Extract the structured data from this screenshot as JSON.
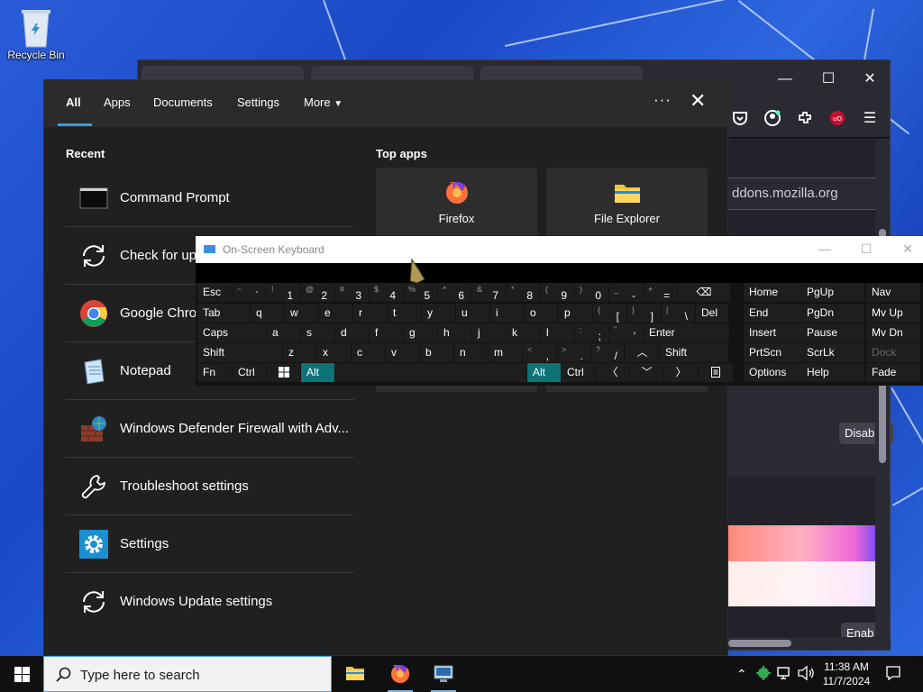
{
  "desktop": {
    "icon_label": "Recycle Bin"
  },
  "firefox_window": {
    "url_partial": "ddons.mozilla.org",
    "button_disable_partial": "Disab",
    "button_enable_partial": "Enab"
  },
  "search_flyout": {
    "tabs": [
      "All",
      "Apps",
      "Documents",
      "Settings",
      "More"
    ],
    "recent_heading": "Recent",
    "top_apps_heading": "Top apps",
    "recent_items": [
      {
        "label": "Command Prompt",
        "icon": "cmd-icon"
      },
      {
        "label": "Check for updates",
        "icon": "refresh-icon"
      },
      {
        "label": "Google Chrome",
        "icon": "chrome-icon"
      },
      {
        "label": "Notepad",
        "icon": "notepad-icon"
      },
      {
        "label": "Windows Defender Firewall with Adv...",
        "icon": "firewall-icon"
      },
      {
        "label": "Troubleshoot settings",
        "icon": "wrench-icon"
      },
      {
        "label": "Settings",
        "icon": "gear-icon"
      },
      {
        "label": "Windows Update settings",
        "icon": "refresh-icon"
      }
    ],
    "top_apps": [
      {
        "label": "Firefox",
        "icon": "firefox-icon"
      },
      {
        "label": "File Explorer",
        "icon": "folder-icon"
      }
    ]
  },
  "osk": {
    "title": "On-Screen Keyboard",
    "row1": [
      {
        "m": "Esc"
      },
      {
        "s": "~",
        "m": "`"
      },
      {
        "s": "!",
        "m": "1"
      },
      {
        "s": "@",
        "m": "2"
      },
      {
        "s": "#",
        "m": "3"
      },
      {
        "s": "$",
        "m": "4"
      },
      {
        "s": "%",
        "m": "5"
      },
      {
        "s": "^",
        "m": "6"
      },
      {
        "s": "&",
        "m": "7"
      },
      {
        "s": "*",
        "m": "8"
      },
      {
        "s": "(",
        "m": "9"
      },
      {
        "s": ")",
        "m": "0"
      },
      {
        "s": "_",
        "m": "-"
      },
      {
        "s": "+",
        "m": "="
      },
      {
        "m": "⌫"
      }
    ],
    "row2": [
      {
        "m": "Tab"
      },
      {
        "m": "q"
      },
      {
        "m": "w"
      },
      {
        "m": "e"
      },
      {
        "m": "r"
      },
      {
        "m": "t"
      },
      {
        "m": "y"
      },
      {
        "m": "u"
      },
      {
        "m": "i"
      },
      {
        "m": "o"
      },
      {
        "m": "p"
      },
      {
        "s": "{",
        "m": "["
      },
      {
        "s": "}",
        "m": "]"
      },
      {
        "s": "|",
        "m": "\\"
      },
      {
        "m": "Del"
      }
    ],
    "row3": [
      {
        "m": "Caps"
      },
      {
        "m": "a"
      },
      {
        "m": "s"
      },
      {
        "m": "d"
      },
      {
        "m": "f"
      },
      {
        "m": "g"
      },
      {
        "m": "h"
      },
      {
        "m": "j"
      },
      {
        "m": "k"
      },
      {
        "m": "l"
      },
      {
        "s": ":",
        "m": ";"
      },
      {
        "s": "\"",
        "m": "'"
      },
      {
        "m": "Enter"
      }
    ],
    "row4": [
      {
        "m": "Shift"
      },
      {
        "m": "z"
      },
      {
        "m": "x"
      },
      {
        "m": "c"
      },
      {
        "m": "v"
      },
      {
        "m": "b"
      },
      {
        "m": "n"
      },
      {
        "m": "m"
      },
      {
        "s": "<",
        "m": ","
      },
      {
        "s": ">",
        "m": "."
      },
      {
        "s": "?",
        "m": "/"
      },
      {
        "m": "^"
      },
      {
        "m": "Shift"
      }
    ],
    "row5": [
      {
        "m": "Fn"
      },
      {
        "m": "Ctrl"
      },
      {
        "m": "win"
      },
      {
        "m": "Alt"
      },
      {
        "m": ""
      },
      {
        "m": "Alt"
      },
      {
        "m": "Ctrl"
      },
      {
        "m": "<"
      },
      {
        "m": "v"
      },
      {
        "m": ">"
      },
      {
        "m": "menu"
      }
    ],
    "nav_keys": [
      [
        "Home",
        "PgUp",
        "Nav"
      ],
      [
        "End",
        "PgDn",
        "Mv Up"
      ],
      [
        "Insert",
        "Pause",
        "Mv Dn"
      ],
      [
        "PrtScn",
        "ScrLk",
        "Dock"
      ],
      [
        "Options",
        "Help",
        "Fade"
      ]
    ],
    "alt_active": true
  },
  "taskbar": {
    "search_placeholder": "Type here to search",
    "time": "11:38 AM",
    "date": "11/7/2024"
  },
  "colors": {
    "accent": "#3b99e0",
    "osk_active": "#0d7377",
    "desktop_blue": "#2a5cd9"
  }
}
